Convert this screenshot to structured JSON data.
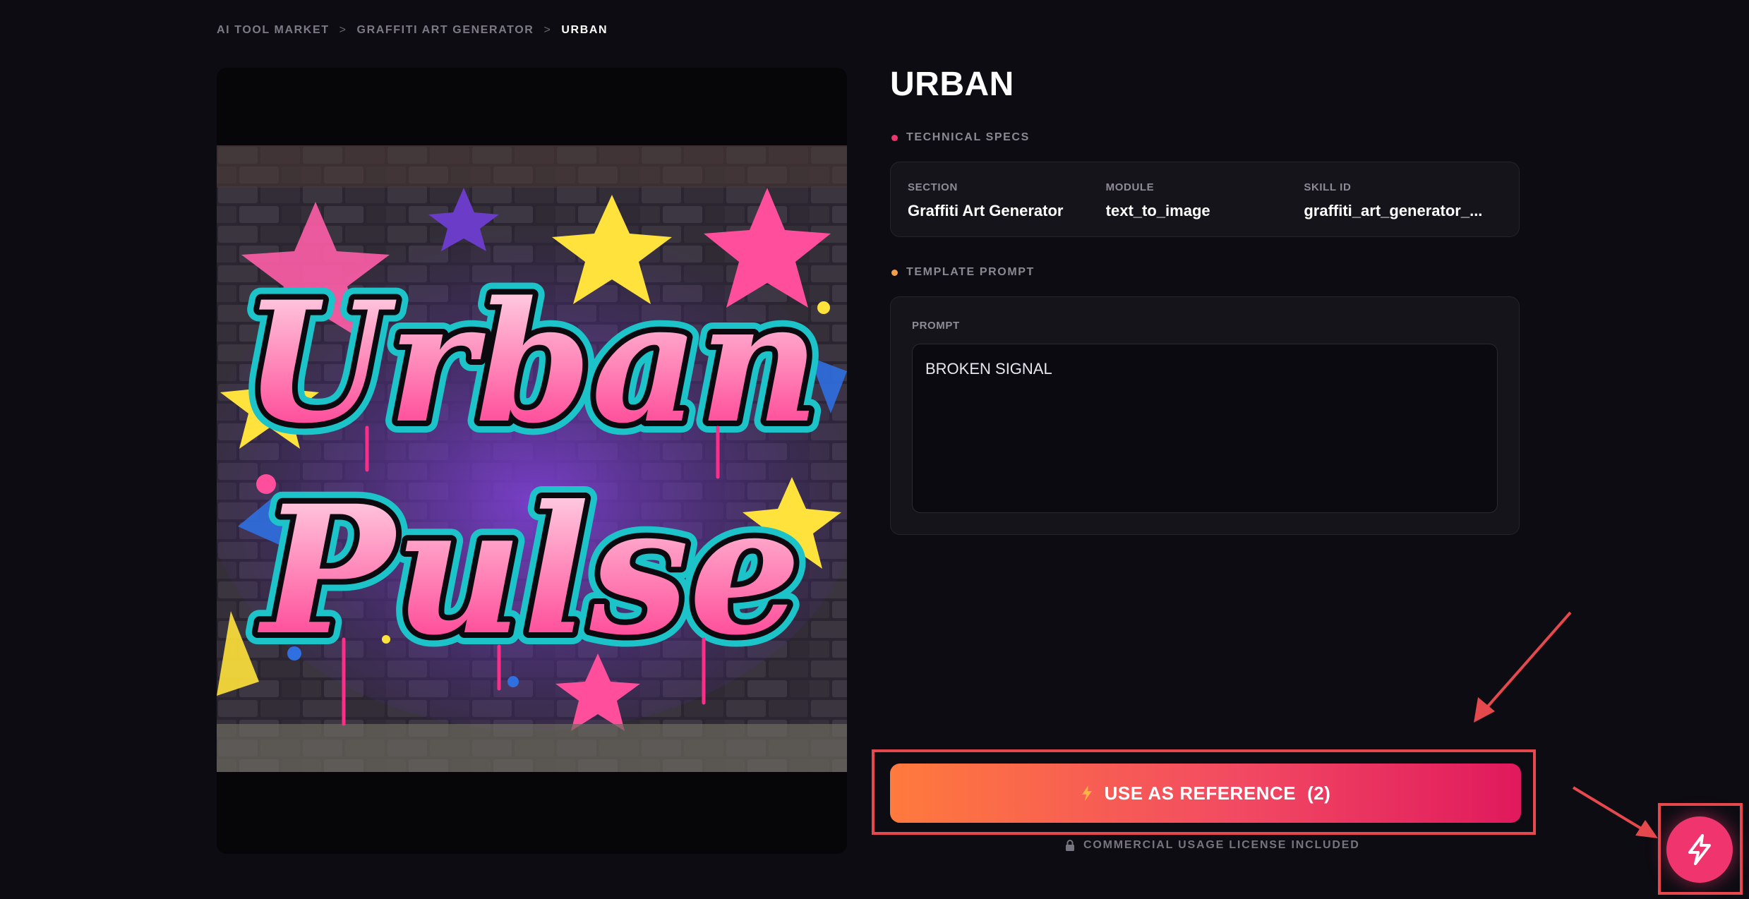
{
  "breadcrumb": {
    "items": [
      "AI TOOL MARKET",
      "GRAFFITI ART GENERATOR"
    ],
    "current": "URBAN",
    "separator": ">"
  },
  "artwork": {
    "text_line1": "Urban",
    "text_line2": "Pulse"
  },
  "page": {
    "title": "URBAN"
  },
  "technical_specs": {
    "heading": "TECHNICAL SPECS",
    "dot_color": "#f0356e",
    "section_label": "SECTION",
    "section_value": "Graffiti Art Generator",
    "module_label": "MODULE",
    "module_value": "text_to_image",
    "skill_label": "SKILL ID",
    "skill_value": "graffiti_art_generator_..."
  },
  "template_prompt": {
    "heading": "TEMPLATE PROMPT",
    "dot_color": "#f59e4a",
    "prompt_label": "PROMPT",
    "prompt_value": "BROKEN SIGNAL"
  },
  "cta": {
    "label": "USE AS REFERENCE",
    "count": "(2)",
    "icon": "bolt-icon",
    "gradient_start": "#ff7a3d",
    "gradient_end": "#e0195d"
  },
  "license": {
    "icon": "lock-icon",
    "text": "COMMERCIAL USAGE LICENSE INCLUDED"
  },
  "fab": {
    "icon": "bolt-icon",
    "color": "#f0356e"
  },
  "annotation": {
    "color": "#e5484d"
  }
}
